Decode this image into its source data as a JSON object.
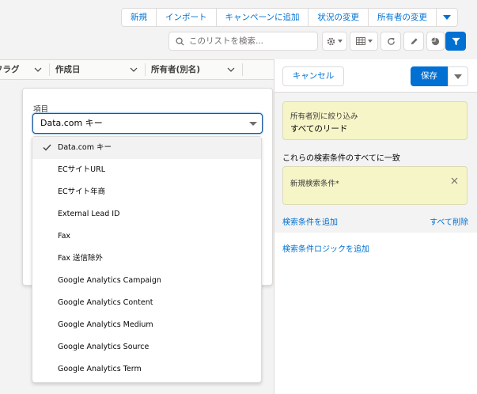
{
  "toolbar": {
    "buttons": [
      "新規",
      "インポート",
      "キャンペーンに追加",
      "状況の変更",
      "所有者の変更"
    ],
    "search_placeholder": "このリストを検索..."
  },
  "table": {
    "columns": [
      "フラグ",
      "作成日",
      "所有者(別名)"
    ]
  },
  "column_editor": {
    "field_label": "項目",
    "selected_value": "Data.com キー",
    "options": [
      "Data.com キー",
      "ECサイトURL",
      "ECサイト年商",
      "External Lead ID",
      "Fax",
      "Fax 送信除外",
      "Google Analytics Campaign",
      "Google Analytics Content",
      "Google Analytics Medium",
      "Google Analytics Source",
      "Google Analytics Term"
    ]
  },
  "filter_panel": {
    "cancel_label": "キャンセル",
    "save_label": "保存",
    "owner_filter_label": "所有者別に絞り込み",
    "owner_filter_value": "すべてのリード",
    "match_text": "これらの検索条件のすべてに一致",
    "new_filter_label": "新規検索条件*",
    "add_filter_link": "検索条件を追加",
    "remove_all_link": "すべて削除",
    "add_logic_link": "検索条件ロジックを追加"
  },
  "colors": {
    "brand_blue": "#0070d2",
    "filter_card_bg": "#f5f5c7",
    "page_bg": "#f3f3f3"
  }
}
